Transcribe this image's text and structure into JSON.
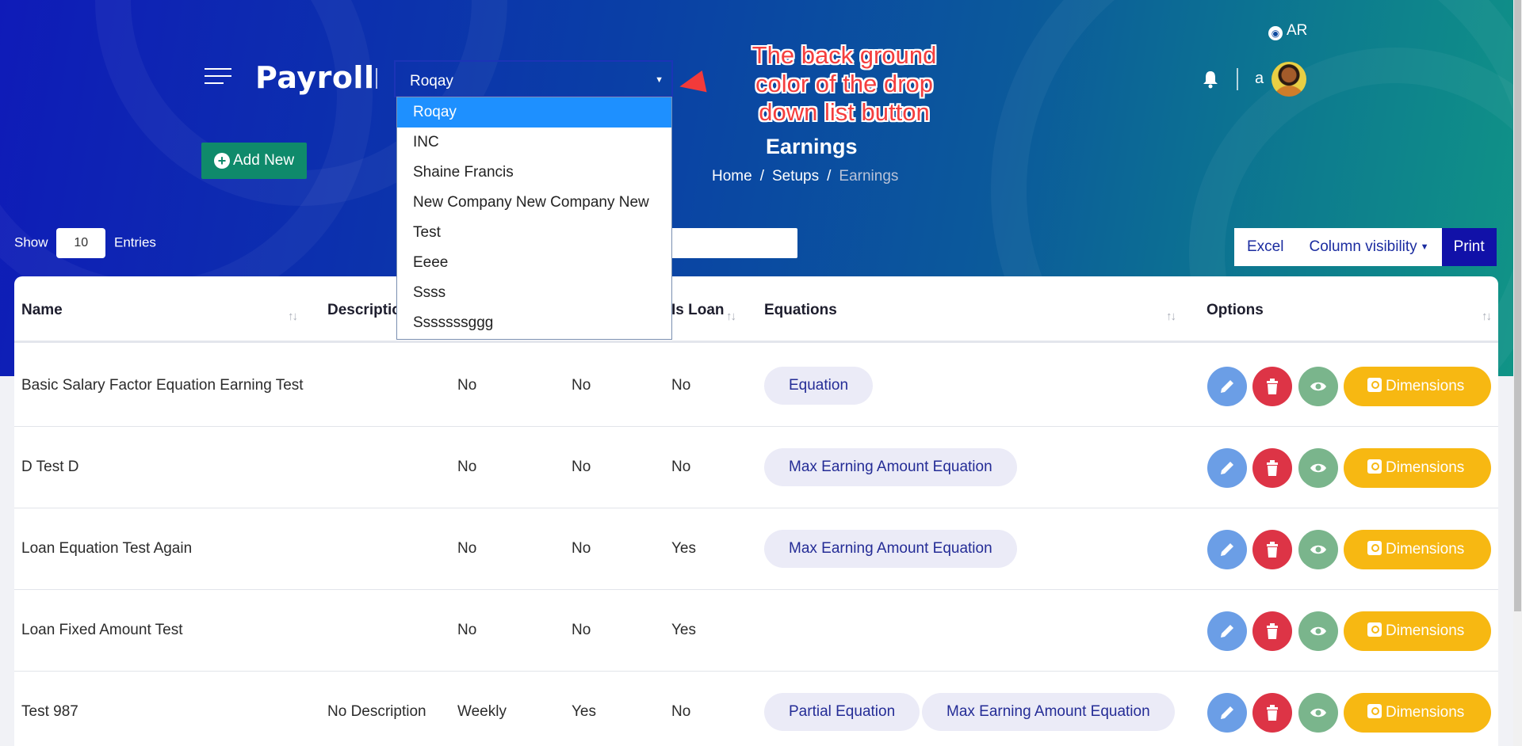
{
  "header": {
    "brand": "Payroll",
    "company_select": {
      "value": "Roqay",
      "options": [
        "Roqay",
        "INC",
        "Shaine Francis",
        "New Company New Company New",
        "Test",
        "Eeee",
        "Ssss",
        "Sssssssggg"
      ]
    },
    "language": "AR",
    "user_name": "a"
  },
  "annotation": {
    "text": "The back ground color of the drop down list button",
    "color": "#f43e3e"
  },
  "actions": {
    "add_new": "Add New"
  },
  "page": {
    "title": "Earnings",
    "breadcrumb": [
      "Home",
      "Setups",
      "Earnings"
    ]
  },
  "table_controls": {
    "show_label": "Show",
    "entries_value": "10",
    "entries_label": "Entries",
    "buttons": {
      "excel": "Excel",
      "column_visibility": "Column visibility",
      "print": "Print"
    }
  },
  "table": {
    "columns": [
      "Name",
      "Description",
      "",
      "",
      "Is Loan",
      "Equations",
      "Options"
    ],
    "rows": [
      {
        "name": "Basic Salary Factor Equation Earning Test",
        "description": "",
        "c3": "No",
        "c4": "No",
        "is_loan": "No",
        "equations": [
          "Equation"
        ]
      },
      {
        "name": "D Test D",
        "description": "",
        "c3": "No",
        "c4": "No",
        "is_loan": "No",
        "equations": [
          "Max Earning Amount Equation"
        ]
      },
      {
        "name": "Loan Equation Test Again",
        "description": "",
        "c3": "No",
        "c4": "No",
        "is_loan": "Yes",
        "equations": [
          "Max Earning Amount Equation"
        ]
      },
      {
        "name": "Loan Fixed Amount Test",
        "description": "",
        "c3": "No",
        "c4": "No",
        "is_loan": "Yes",
        "equations": []
      },
      {
        "name": "Test 987",
        "description": "No Description",
        "c3": "Weekly",
        "c4": "Yes",
        "is_loan": "No",
        "equations": [
          "Partial Equation",
          "Max Earning Amount Equation"
        ]
      }
    ],
    "dimensions_label": "Dimensions"
  },
  "colors": {
    "hero_start": "#0f1bb8",
    "hero_end": "#109586",
    "add_new": "#0f8a6b",
    "edit": "#6b9ee6",
    "delete": "#dd3446",
    "view": "#7ab58c",
    "dimensions": "#f7b812",
    "selected_option": "#1e90ff"
  }
}
